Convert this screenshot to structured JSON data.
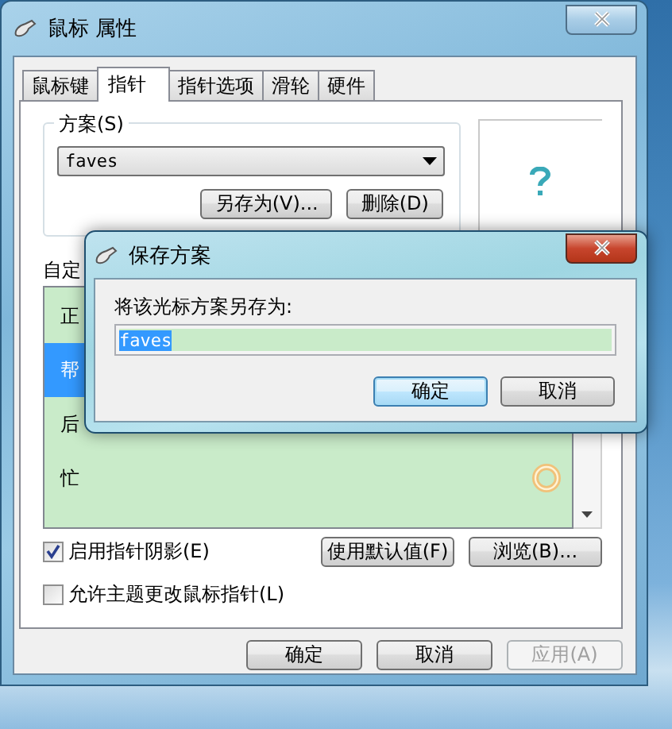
{
  "main_window": {
    "title": "鼠标 属性",
    "tabs": [
      {
        "label": "鼠标键",
        "selected": false
      },
      {
        "label": "指针",
        "selected": true
      },
      {
        "label": "指针选项",
        "selected": false
      },
      {
        "label": "滑轮",
        "selected": false
      },
      {
        "label": "硬件",
        "selected": false
      }
    ],
    "scheme": {
      "label": "方案(S)",
      "value": "faves",
      "buttons": [
        "另存为(V)...",
        "删除(D)"
      ]
    },
    "customize_label": "自定",
    "cursor_list": [
      {
        "name": "正",
        "selected": false,
        "kind": "plain"
      },
      {
        "name": "帮",
        "selected": true,
        "kind": "plain"
      },
      {
        "name": "后",
        "selected": false,
        "kind": "plain"
      },
      {
        "name": "忙",
        "selected": false,
        "kind": "busy"
      }
    ],
    "options": [
      {
        "label": "启用指针阴影(E)",
        "checked": true
      },
      {
        "label": "允许主题更改鼠标指针(L)",
        "checked": false
      }
    ],
    "list_buttons": [
      "使用默认值(F)",
      "浏览(B)..."
    ],
    "footer_buttons": [
      {
        "label": "确定",
        "disabled": false
      },
      {
        "label": "取消",
        "disabled": false
      },
      {
        "label": "应用(A)",
        "disabled": true
      }
    ]
  },
  "save_dialog": {
    "title": "保存方案",
    "prompt": "将该光标方案另存为:",
    "value": "faves",
    "text_selected": true,
    "buttons": [
      {
        "label": "确定",
        "default": true
      },
      {
        "label": "取消",
        "default": false
      }
    ]
  }
}
